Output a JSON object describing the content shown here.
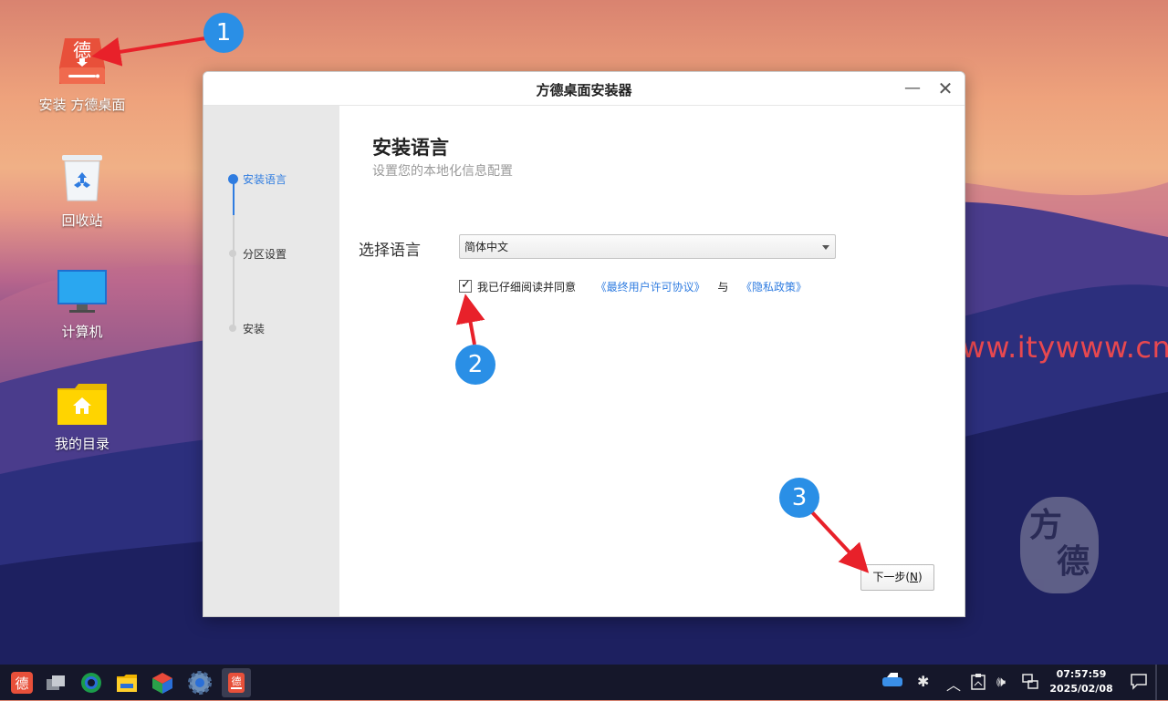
{
  "desktop": {
    "icons": [
      {
        "label": "安装 方德桌面"
      },
      {
        "label": "回收站"
      },
      {
        "label": "计算机"
      },
      {
        "label": "我的目录"
      }
    ],
    "installer_icon_glyph": "德",
    "watermark": "www.itywww.cn",
    "seal_chars": [
      "方",
      "德"
    ]
  },
  "callouts": [
    "1",
    "2",
    "3"
  ],
  "window": {
    "title": "方德桌面安装器",
    "minimize_glyph": "—",
    "close_glyph": "✕",
    "steps": [
      {
        "label": "安装语言",
        "active": true
      },
      {
        "label": "分区设置",
        "active": false
      },
      {
        "label": "安装",
        "active": false
      }
    ],
    "heading": "安装语言",
    "subheading": "设置您的本地化信息配置",
    "language_label": "选择语言",
    "language_value": "简体中文",
    "agree_checked": true,
    "agree_text": "我已仔细阅读并同意",
    "eula_link": "《最终用户许可协议》",
    "and_text": "与",
    "privacy_link": "《隐私政策》",
    "next_button": "下一步(",
    "next_button_key": "N",
    "next_button_end": ")"
  },
  "taskbar": {
    "apps": [
      {
        "icon": "fangde-start-icon",
        "glyph": "德"
      },
      {
        "icon": "multitask-view-icon"
      },
      {
        "icon": "browser-icon"
      },
      {
        "icon": "file-manager-icon"
      },
      {
        "icon": "app-store-icon"
      },
      {
        "icon": "settings-gear-icon"
      },
      {
        "icon": "installer-icon",
        "glyph": "德"
      }
    ],
    "tray": [
      "drive-icon",
      "bluetooth-icon",
      "expand-tray-icon",
      "clipboard-icon",
      "volume-icon",
      "network-icon"
    ],
    "time": "07:57:59",
    "date": "2025/02/08"
  },
  "colors": {
    "accent": "#2f7ce0",
    "callout": "#2a8fe6",
    "arrow": "#e8212a",
    "watermark": "#e8484f"
  }
}
